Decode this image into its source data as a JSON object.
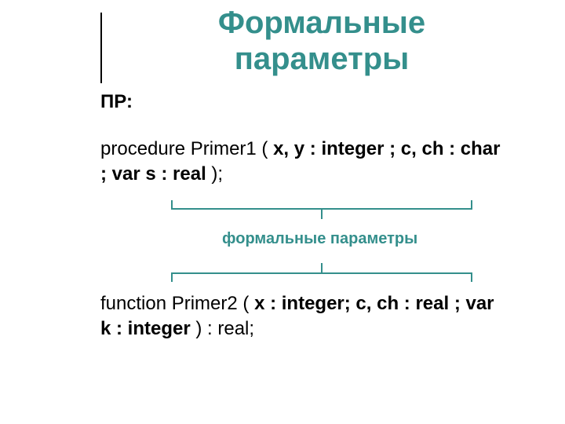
{
  "colors": {
    "accent": "#348f8c"
  },
  "title_line1": "Формальные",
  "title_line2": "параметры",
  "label_pr": "ПР:",
  "proc": {
    "head": "procedure Primer1 ( ",
    "params_bold": "x, y : integer ; c, ch : char ; var s : real",
    "tail": " );"
  },
  "annotation": "формальные параметры",
  "func": {
    "head": "function Primer2 ( ",
    "params_bold": "x : integer; c, ch : real ; var k : integer",
    "tail": " ) : real;"
  }
}
